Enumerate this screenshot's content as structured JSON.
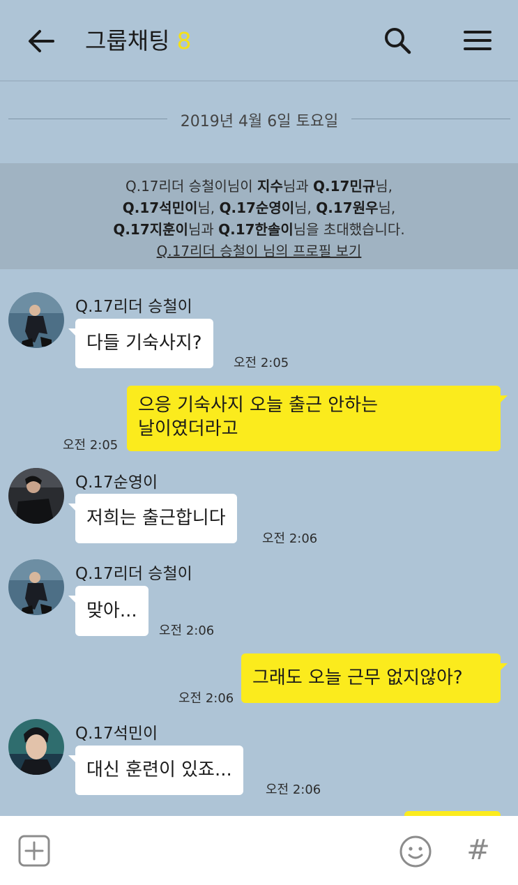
{
  "header": {
    "title": "그룹채팅",
    "member_count": "8",
    "icons": {
      "back": "arrow-left-icon",
      "search": "search-icon",
      "menu": "hamburger-menu-icon"
    },
    "count_color": "#f4e11a"
  },
  "date_divider": "2019년 4월 6일 토요일",
  "notice": {
    "inviter": "Q.17리더 승철이",
    "seg1": "님이 ",
    "invitee1": "지수",
    "seg2": "님과 ",
    "invitee2": "Q.17민규",
    "seg3": "님,",
    "invitee3": "Q.17석민이",
    "seg4": "님, ",
    "invitee4": "Q.17순영이",
    "seg5": "님, ",
    "invitee5": "Q.17원우",
    "seg6": "님,",
    "invitee6": "Q.17지훈이",
    "seg7": "님과 ",
    "invitee7": "Q.17한솔이",
    "seg8": "님을 초대했습니다.",
    "profile_link": "Q.17리더 승철이 님의 프로필 보기"
  },
  "messages": [
    {
      "sender": "Q.17리더 승철이",
      "text": "다들 기숙사지?",
      "time": "오전 2:05",
      "direction": "in"
    },
    {
      "lines": [
        "으응 기숙사지 오늘 출근 안하는",
        "날이였더라고"
      ],
      "time": "오전 2:05",
      "direction": "out"
    },
    {
      "sender": "Q.17순영이",
      "text": "저희는 출근합니다",
      "time": "오전 2:06",
      "direction": "in"
    },
    {
      "sender": "Q.17리더 승철이",
      "text": "맞아...",
      "time": "오전 2:06",
      "direction": "in"
    },
    {
      "text": "그래도 오늘 근무 없지않아?",
      "time": "오전 2:06",
      "direction": "out"
    },
    {
      "sender": "Q.17석민이",
      "text": "대신 훈련이 있죠...",
      "time": "오전 2:06",
      "direction": "in"
    }
  ],
  "bottom_bar": {
    "icons": {
      "attach": "plus-square-icon",
      "emoji": "emoji-icon",
      "hashtag": "hashtag-icon"
    },
    "hash_glyph": "#"
  },
  "colors": {
    "background": "#aec4d6",
    "outgoing_bubble": "#fbeb1d",
    "incoming_bubble": "#ffffff",
    "notice_band": "#a0b3c2"
  }
}
